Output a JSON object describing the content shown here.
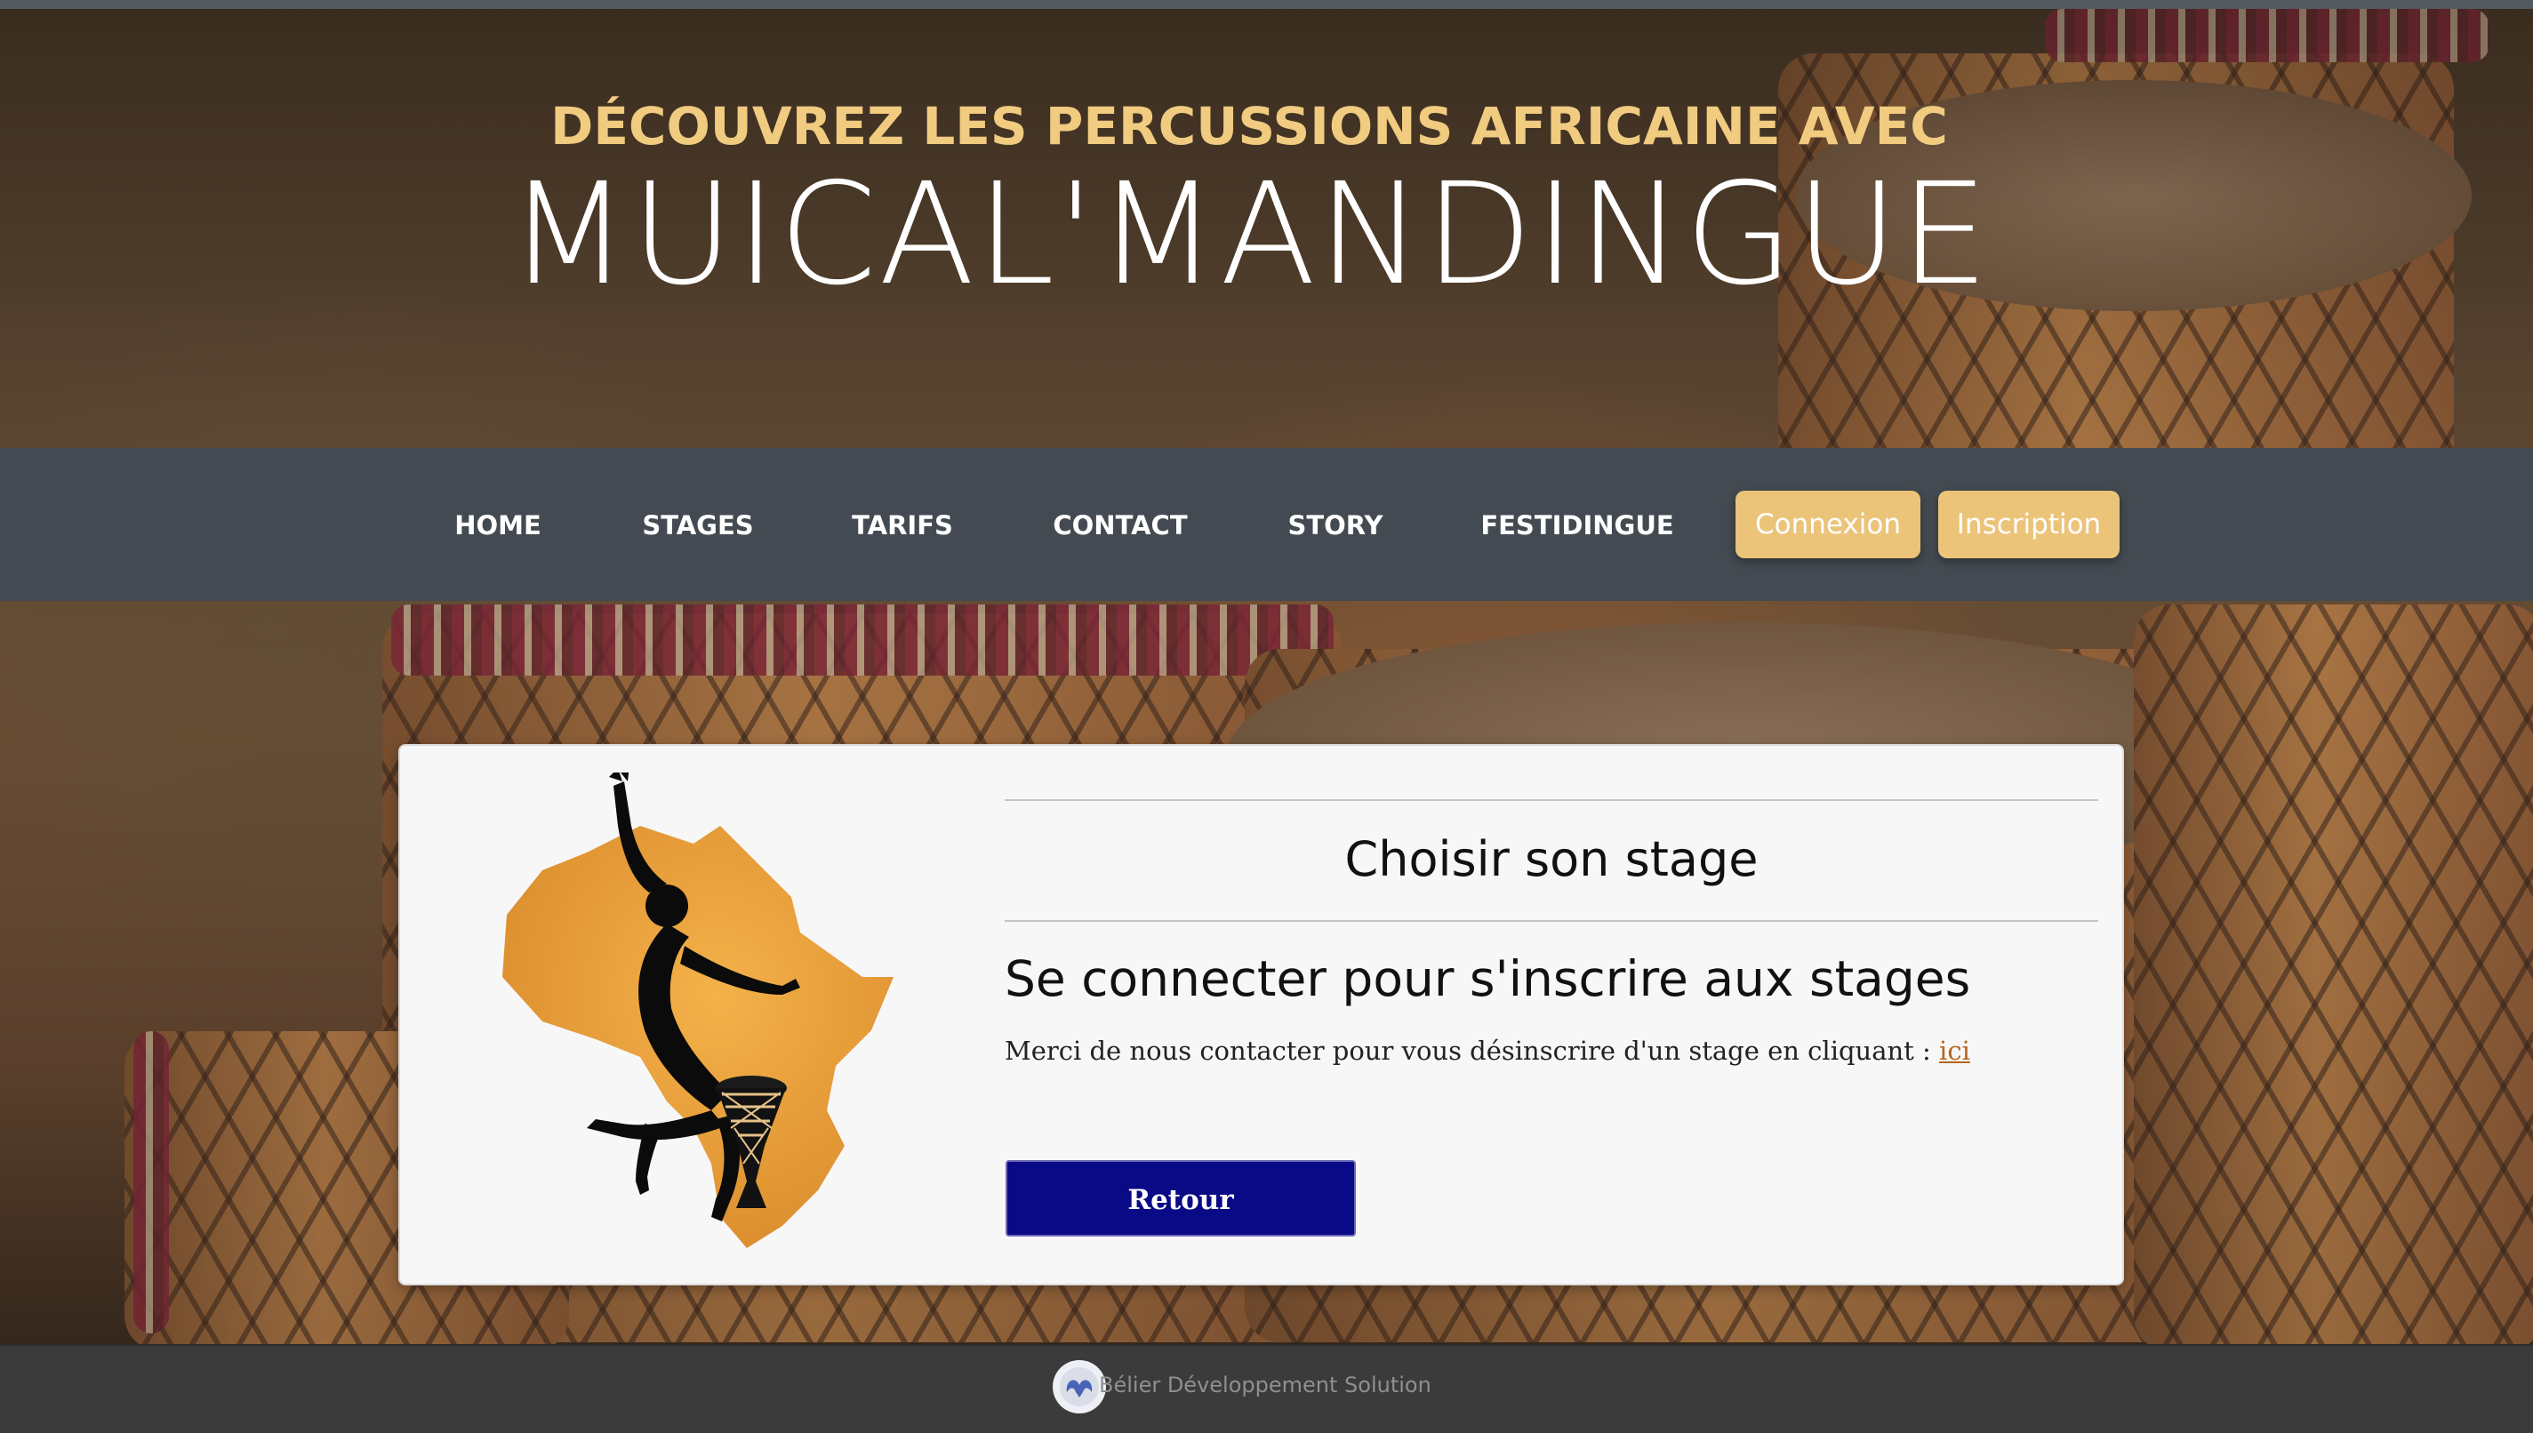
{
  "hero": {
    "subtitle": "DÉCOUVREZ LES PERCUSSIONS AFRICAINE AVEC",
    "title": "MUICAL'MANDINGUE"
  },
  "nav": {
    "items": [
      {
        "label": "HOME"
      },
      {
        "label": "STAGES"
      },
      {
        "label": "TARIFS"
      },
      {
        "label": "CONTACT"
      },
      {
        "label": "STORY"
      },
      {
        "label": "FESTIDINGUE"
      }
    ],
    "login_label": "Connexion",
    "signup_label": "Inscription"
  },
  "card": {
    "title": "Choisir son stage",
    "heading": "Se connecter pour s'inscrire aux stages",
    "text": "Merci de nous contacter pour vous désinscrire d'un stage en cliquant : ",
    "link_label": "ici",
    "back_label": "Retour"
  },
  "footer": {
    "text": "Bélier Développement Solution"
  },
  "colors": {
    "accent_gold": "#f0cb80",
    "button_gold": "#ebc47a",
    "nav_bg": "#434a51",
    "back_button": "#0a0a86",
    "link": "#b5651d"
  },
  "icons": {
    "logo": "africa-dancer-djembe-logo",
    "footer_logo": "ram-logo"
  }
}
